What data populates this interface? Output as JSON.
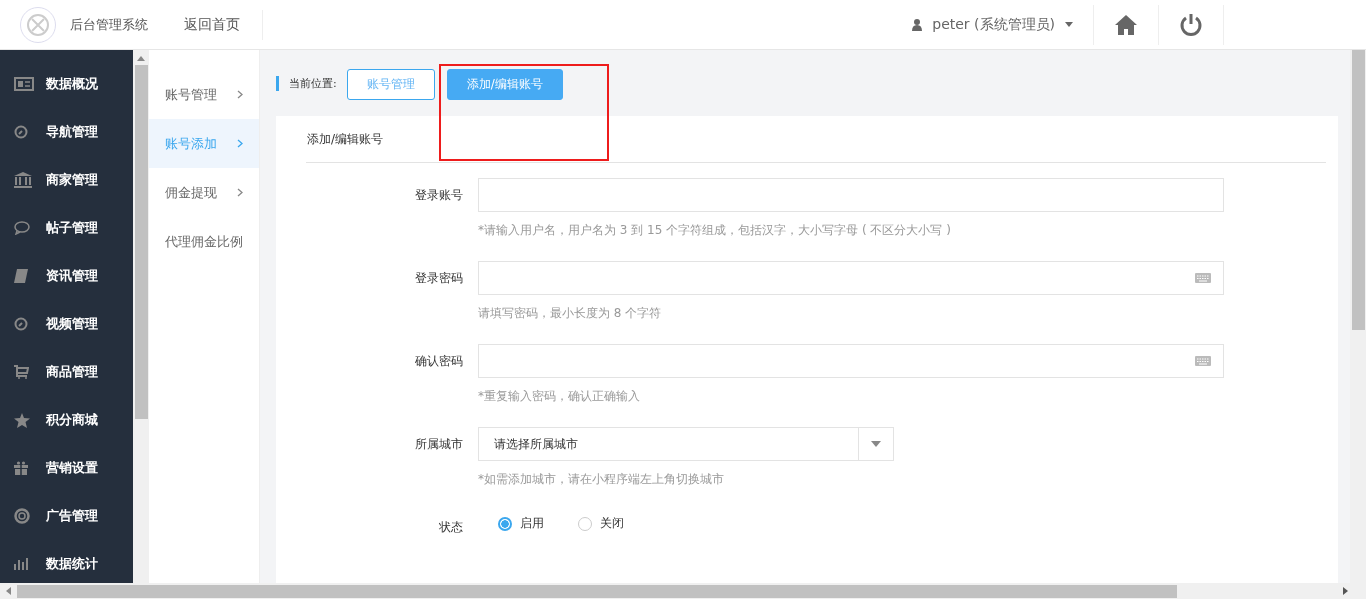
{
  "header": {
    "logo_title": "后台管理系统",
    "home_link": "返回首页",
    "user": "peter (系统管理员)"
  },
  "sidebar": {
    "items": [
      {
        "label": "数据概况"
      },
      {
        "label": "导航管理"
      },
      {
        "label": "商家管理"
      },
      {
        "label": "帖子管理"
      },
      {
        "label": "资讯管理"
      },
      {
        "label": "视频管理"
      },
      {
        "label": "商品管理"
      },
      {
        "label": "积分商城"
      },
      {
        "label": "营销设置"
      },
      {
        "label": "广告管理"
      },
      {
        "label": "数据统计"
      }
    ]
  },
  "submenu": {
    "items": [
      {
        "label": "账号管理",
        "selected": false,
        "has_children": true
      },
      {
        "label": "账号添加",
        "selected": true,
        "has_children": true
      },
      {
        "label": "佣金提现",
        "selected": false,
        "has_children": true
      },
      {
        "label": "代理佣金比例",
        "selected": false,
        "has_children": false
      }
    ]
  },
  "breadcrumb": {
    "label": "当前位置:",
    "items": [
      {
        "label": "账号管理",
        "selected": false
      },
      {
        "label": "添加/编辑账号",
        "selected": true
      }
    ]
  },
  "form": {
    "title": "添加/编辑账号",
    "fields": [
      {
        "kind": "text",
        "label": "登录账号",
        "hint": "*请输入用户名，用户名为 3 到 15 个字符组成，包括汉字，大小写字母 ( 不区分大小写 )"
      },
      {
        "kind": "password",
        "label": "登录密码",
        "hint": "请填写密码，最小长度为 8 个字符"
      },
      {
        "kind": "password",
        "label": "确认密码",
        "hint": "*重复输入密码，确认正确输入"
      },
      {
        "kind": "select",
        "label": "所属城市",
        "value": "请选择所属城市",
        "hint": "*如需添加城市，请在小程序端左上角切换城市"
      },
      {
        "kind": "radio",
        "label": "状态",
        "options": [
          {
            "label": "启用",
            "selected": true
          },
          {
            "label": "关闭",
            "selected": false
          }
        ]
      }
    ]
  }
}
